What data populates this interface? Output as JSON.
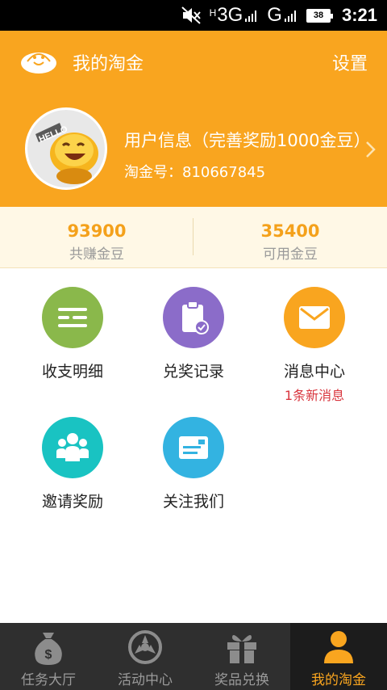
{
  "status_bar": {
    "network_h": "H",
    "network_3g": "3G",
    "network_g": "G",
    "battery": "38",
    "time": "3:21",
    "icons": [
      "mute-icon",
      "signal-icon",
      "signal-icon",
      "battery-icon"
    ]
  },
  "header": {
    "title": "我的淘金",
    "settings_label": "设置",
    "background_color": "#f9a51f"
  },
  "profile": {
    "avatar_text": "HELLO",
    "user_info": "用户信息（完善奖励1000金豆）",
    "user_id_label": "淘金号：810667845"
  },
  "stats": [
    {
      "value": "93900",
      "label": "共赚金豆"
    },
    {
      "value": "35400",
      "label": "可用金豆"
    }
  ],
  "menu": [
    {
      "label": "收支明细",
      "icon": "list-icon",
      "color": "#8ab84b"
    },
    {
      "label": "兑奖记录",
      "icon": "clipboard-check-icon",
      "color": "#8b6cc9"
    },
    {
      "label": "消息中心",
      "icon": "mail-icon",
      "color": "#f9a51f",
      "sub": "1条新消息"
    },
    {
      "label": "邀请奖励",
      "icon": "people-icon",
      "color": "#19c3c2"
    },
    {
      "label": "关注我们",
      "icon": "news-icon",
      "color": "#33b3e1"
    }
  ],
  "tabs": [
    {
      "label": "任务大厅",
      "icon": "money-bag-icon",
      "active": false
    },
    {
      "label": "活动中心",
      "icon": "wheel-icon",
      "active": false
    },
    {
      "label": "奖品兑换",
      "icon": "gift-icon",
      "active": false
    },
    {
      "label": "我的淘金",
      "icon": "user-icon",
      "active": true
    }
  ],
  "colors": {
    "accent": "#f9a51f",
    "alert": "#d9363e",
    "tabbar": "#2f2f2f"
  }
}
